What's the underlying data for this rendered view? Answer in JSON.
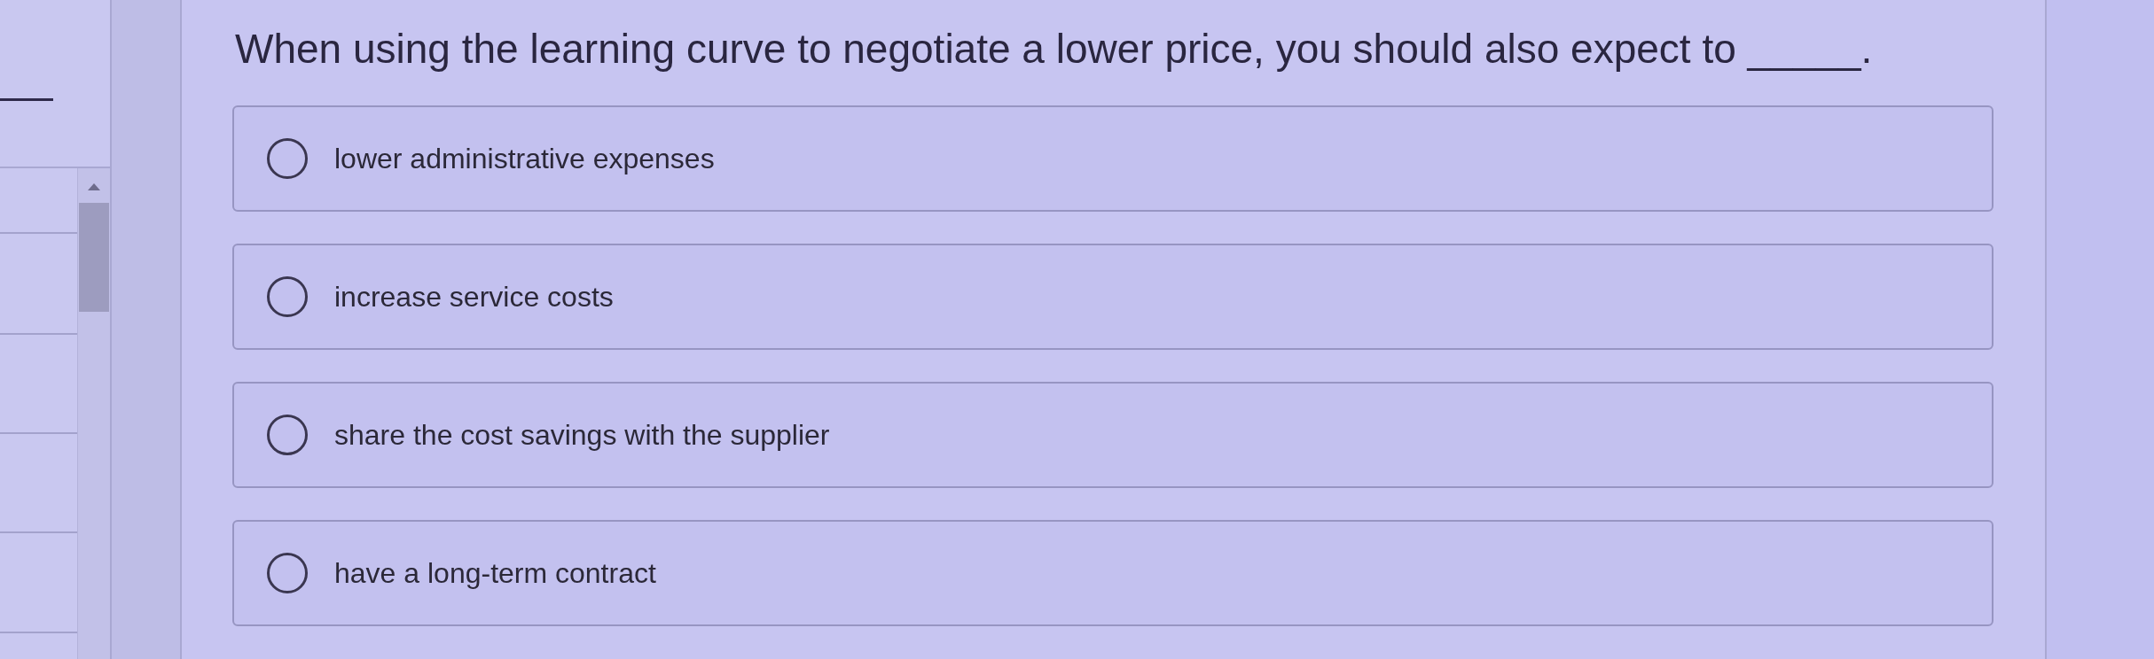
{
  "question": {
    "text": "When using the learning curve to negotiate a lower price, you should also expect to _____."
  },
  "options": [
    {
      "label": "lower administrative expenses",
      "selected": false
    },
    {
      "label": "increase service costs",
      "selected": false
    },
    {
      "label": "share the cost savings with the supplier",
      "selected": false
    },
    {
      "label": "have a long-term contract",
      "selected": false
    }
  ]
}
